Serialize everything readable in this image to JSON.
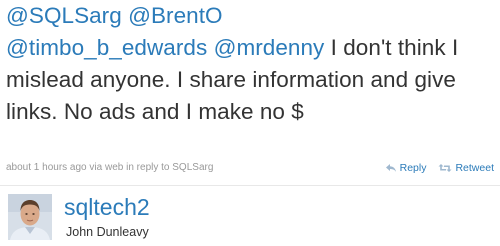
{
  "tweet": {
    "mentions": [
      "@SQLSarg",
      "@BrentO",
      "@timbo_b_edwards",
      "@mrdenny"
    ],
    "text": " I don't think I mislead anyone. I share information and give links. No ads and I make no $"
  },
  "meta": {
    "time": "about 1 hours ago",
    "via_label": "via",
    "source": "web",
    "reply_prefix": "in reply to",
    "reply_to": "SQLSarg"
  },
  "actions": {
    "reply_label": "Reply",
    "retweet_label": "Retweet"
  },
  "author": {
    "screen_name": "sqltech2",
    "full_name": "John Dunleavy"
  },
  "colors": {
    "link": "#2b7bb9",
    "text": "#333333",
    "meta": "#999999"
  }
}
